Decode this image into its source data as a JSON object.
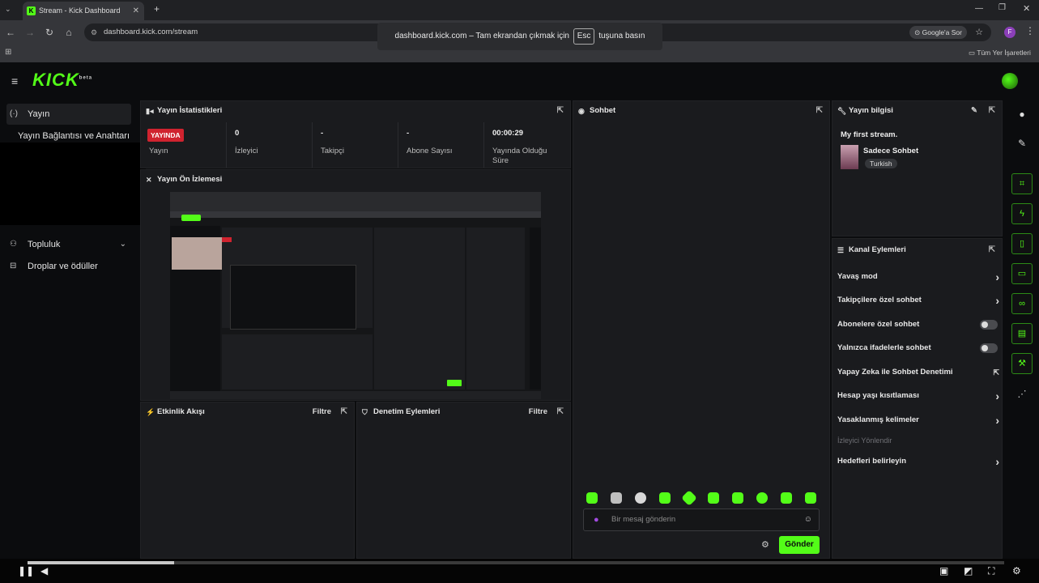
{
  "browser": {
    "tab_title": "Stream - Kick Dashboard",
    "tab_favicon": "K",
    "url": "dashboard.kick.com/stream",
    "fullscreen_notice_before": "dashboard.kick.com – Tam ekrandan çıkmak için",
    "fullscreen_notice_key": "Esc",
    "fullscreen_notice_after": "tuşuna basın",
    "google_lens_label": "Google'a Sor",
    "profile_initial": "F",
    "bookmarks_label": "Tüm Yer İşaretleri"
  },
  "app": {
    "logo": "KICK",
    "logo_badge": "beta"
  },
  "sidebar": {
    "items": [
      {
        "label": "Yayın",
        "icon": "broadcast-icon"
      },
      {
        "label": "Yayın Bağlantısı ve Anahtarı"
      },
      {
        "label": "Topluluk",
        "icon": "community-icon"
      },
      {
        "label": "Droplar ve ödüller",
        "icon": "gift-icon"
      }
    ]
  },
  "stats": {
    "title": "Yayın İstatistikleri",
    "live_badge": "YAYINDA",
    "items": [
      {
        "value": "",
        "label": "Yayın"
      },
      {
        "value": "0",
        "label": "İzleyici"
      },
      {
        "value": "-",
        "label": "Takipçi"
      },
      {
        "value": "-",
        "label": "Abone Sayısı"
      },
      {
        "value": "00:00:29",
        "label": "Yayında Olduğu Süre"
      }
    ]
  },
  "preview": {
    "title": "Yayın Ön İzlemesi"
  },
  "activity": {
    "title": "Etkinlik Akışı",
    "filter": "Filtre"
  },
  "moderation": {
    "title": "Denetim Eylemleri",
    "filter": "Filtre"
  },
  "chat": {
    "title": "Sohbet",
    "placeholder": "Bir mesaj gönderin",
    "send": "Gönder"
  },
  "stream_info": {
    "title": "Yayın bilgisi",
    "stream_title": "My first stream.",
    "category": "Sadece Sohbet",
    "language": "Turkish"
  },
  "channel_actions": {
    "title": "Kanal Eylemleri",
    "items": [
      {
        "label": "Yavaş mod",
        "kind": "chevron"
      },
      {
        "label": "Takipçilere özel sohbet",
        "kind": "chevron"
      },
      {
        "label": "Abonelere özel sohbet",
        "kind": "toggle"
      },
      {
        "label": "Yalnızca ifadelerle sohbet",
        "kind": "toggle"
      },
      {
        "label": "Yapay Zeka ile Sohbet Denetimi",
        "kind": "external"
      },
      {
        "label": "Hesap yaşı kısıtlaması",
        "kind": "chevron"
      },
      {
        "label": "Yasaklanmış kelimeler",
        "kind": "chevron"
      },
      {
        "label": "İzleyici Yönlendir",
        "kind": "disabled"
      },
      {
        "label": "Hedefleri belirleyin",
        "kind": "chevron"
      }
    ]
  },
  "colors": {
    "accent": "#53fc18",
    "live": "#d0232f",
    "panel": "#1a1b1e"
  },
  "video_player": {
    "progress": 0.15
  }
}
